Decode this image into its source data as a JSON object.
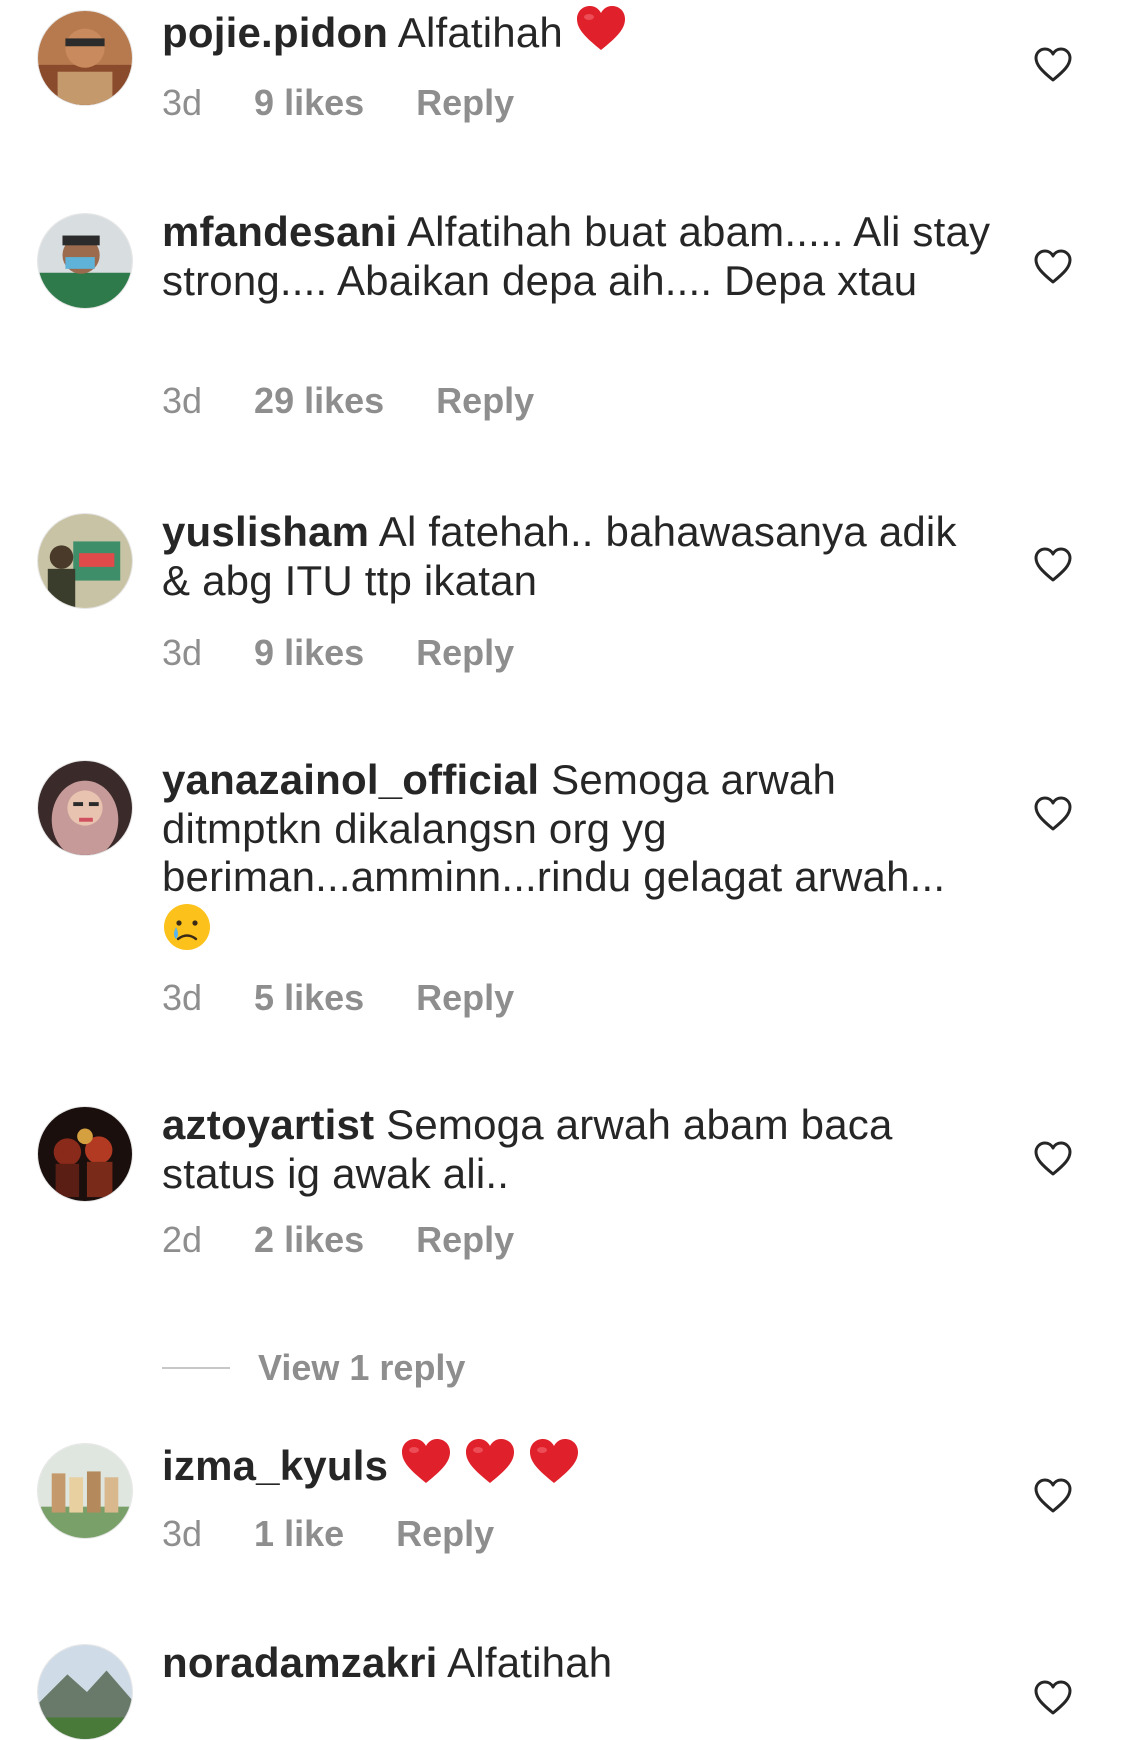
{
  "comments": [
    {
      "username": "pojie.pidon",
      "text": "Alfatihah",
      "time": "3d",
      "likes": "9 likes",
      "reply": "Reply",
      "emoji": [
        "red-heart"
      ]
    },
    {
      "username": "mfandesani",
      "text": "Alfatihah buat abam..... Ali stay strong.... Abaikan depa aih.... Depa xtau",
      "time": "3d",
      "likes": "29 likes",
      "reply": "Reply",
      "emoji": []
    },
    {
      "username": "yuslisham",
      "text": "Al fatehah.. bahawasanya adik & abg ITU ttp ikatan",
      "time": "3d",
      "likes": "9 likes",
      "reply": "Reply",
      "emoji": []
    },
    {
      "username": "yanazainol_official",
      "text": "Semoga arwah ditmptkn dikalangsn org yg beriman...amminn...rindu gelagat arwah...",
      "time": "3d",
      "likes": "5 likes",
      "reply": "Reply",
      "emoji": [
        "crying-face"
      ]
    },
    {
      "username": "aztoyartist",
      "text": "Semoga arwah abam baca status ig awak ali..",
      "time": "2d",
      "likes": "2 likes",
      "reply": "Reply",
      "emoji": [],
      "view_replies": "View 1 reply"
    },
    {
      "username": "izma_kyuls",
      "text": "",
      "time": "3d",
      "likes": "1 like",
      "reply": "Reply",
      "emoji": [
        "red-heart",
        "red-heart",
        "red-heart"
      ]
    },
    {
      "username": "noradamzakri",
      "text": "Alfatihah",
      "emoji": []
    }
  ],
  "icons": {
    "like": "heart-outline-icon"
  },
  "colors": {
    "text": "#262626",
    "secondary": "#8e8e8e",
    "heart_emoji": "#e0202a"
  }
}
